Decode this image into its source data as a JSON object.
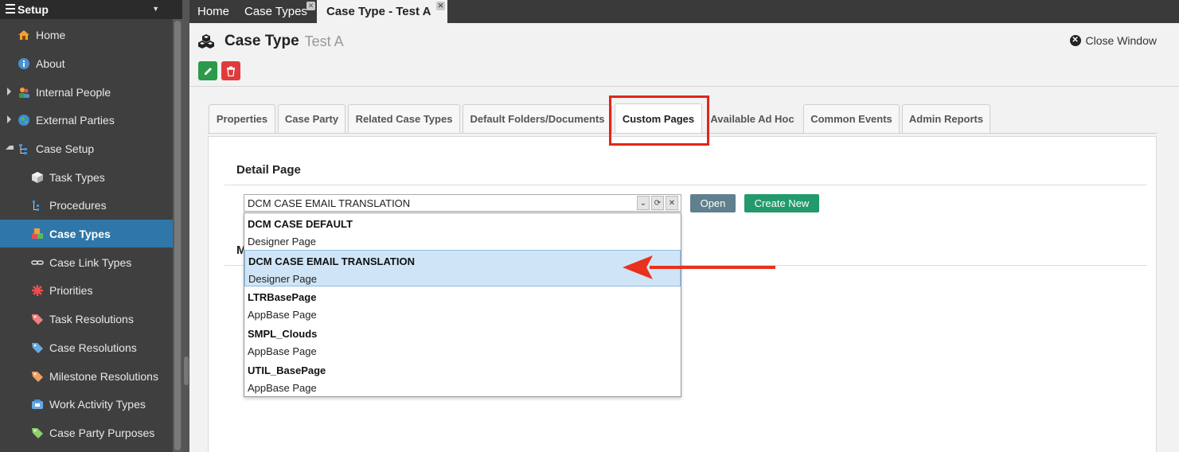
{
  "sidebar": {
    "header": "Setup",
    "items": [
      {
        "label": "Home",
        "icon": "home-icon"
      },
      {
        "label": "About",
        "icon": "info-icon"
      },
      {
        "label": "Internal People",
        "icon": "people-icon"
      },
      {
        "label": "External Parties",
        "icon": "globe-icon"
      },
      {
        "label": "Case Setup",
        "icon": "tree-icon"
      },
      {
        "label": "Task Types",
        "icon": "cube-icon"
      },
      {
        "label": "Procedures",
        "icon": "procedure-icon"
      },
      {
        "label": "Case Types",
        "icon": "cubes-icon"
      },
      {
        "label": "Case Link Types",
        "icon": "link-icon"
      },
      {
        "label": "Priorities",
        "icon": "asterisk-icon"
      },
      {
        "label": "Task Resolutions",
        "icon": "tag-icon"
      },
      {
        "label": "Case Resolutions",
        "icon": "tag-icon"
      },
      {
        "label": "Milestone Resolutions",
        "icon": "tag-icon"
      },
      {
        "label": "Work Activity Types",
        "icon": "phone-icon"
      },
      {
        "label": "Case Party Purposes",
        "icon": "tag-icon"
      }
    ]
  },
  "top_tabs": [
    {
      "label": "Home"
    },
    {
      "label": "Case Types"
    },
    {
      "label": "Case Type - Test A"
    }
  ],
  "header": {
    "title": "Case Type",
    "subtitle": "Test A",
    "close_label": "Close Window"
  },
  "tabs": [
    {
      "label": "Properties"
    },
    {
      "label": "Case Party"
    },
    {
      "label": "Related Case Types"
    },
    {
      "label": "Default Folders/Documents"
    },
    {
      "label": "Custom Pages"
    },
    {
      "label": "Available Ad Hoc"
    },
    {
      "label": "Common Events"
    },
    {
      "label": "Admin Reports"
    }
  ],
  "detail": {
    "section_title": "Detail Page",
    "section2_title": "M",
    "selected_value": "DCM CASE EMAIL TRANSLATION",
    "open_label": "Open",
    "create_label": "Create New",
    "options": [
      {
        "name": "DCM CASE DEFAULT",
        "desc": "Designer Page"
      },
      {
        "name": "DCM CASE EMAIL TRANSLATION",
        "desc": "Designer Page"
      },
      {
        "name": "LTRBasePage",
        "desc": "AppBase Page"
      },
      {
        "name": "SMPL_Clouds",
        "desc": "AppBase Page"
      },
      {
        "name": "UTIL_BasePage",
        "desc": "AppBase Page"
      }
    ]
  },
  "colors": {
    "active_sidebar": "#2f77a8",
    "highlight": "#e0261a",
    "create_button": "#229a6b",
    "open_button": "#607f8f"
  }
}
